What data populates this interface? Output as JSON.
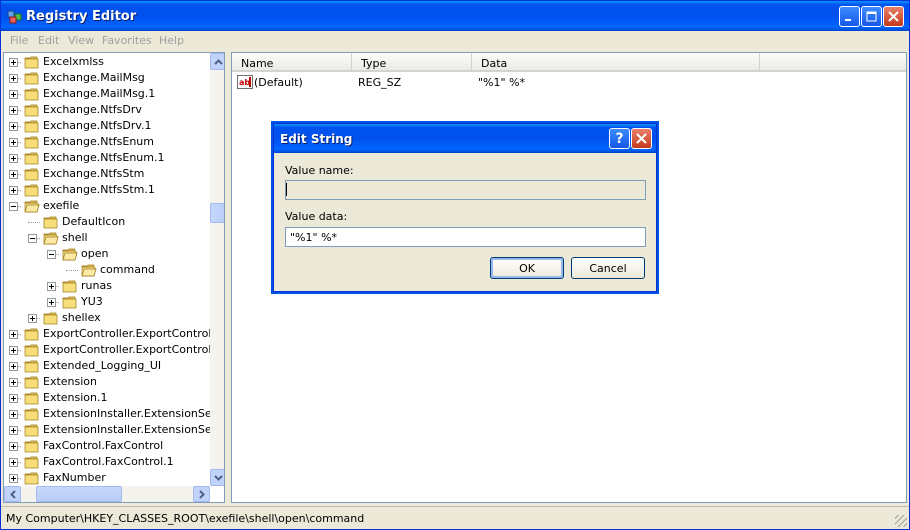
{
  "window": {
    "title": "Registry Editor"
  },
  "menu": [
    "File",
    "Edit",
    "View",
    "Favorites",
    "Help"
  ],
  "tree": [
    {
      "label": "Excelxmlss",
      "depth": 0,
      "expander": "plus"
    },
    {
      "label": "Exchange.MailMsg",
      "depth": 0,
      "expander": "plus"
    },
    {
      "label": "Exchange.MailMsg.1",
      "depth": 0,
      "expander": "plus"
    },
    {
      "label": "Exchange.NtfsDrv",
      "depth": 0,
      "expander": "plus"
    },
    {
      "label": "Exchange.NtfsDrv.1",
      "depth": 0,
      "expander": "plus"
    },
    {
      "label": "Exchange.NtfsEnum",
      "depth": 0,
      "expander": "plus"
    },
    {
      "label": "Exchange.NtfsEnum.1",
      "depth": 0,
      "expander": "plus"
    },
    {
      "label": "Exchange.NtfsStm",
      "depth": 0,
      "expander": "plus"
    },
    {
      "label": "Exchange.NtfsStm.1",
      "depth": 0,
      "expander": "plus"
    },
    {
      "label": "exefile",
      "depth": 0,
      "expander": "minus"
    },
    {
      "label": "DefaultIcon",
      "depth": 1,
      "expander": "none"
    },
    {
      "label": "shell",
      "depth": 1,
      "expander": "minus"
    },
    {
      "label": "open",
      "depth": 2,
      "expander": "minus"
    },
    {
      "label": "command",
      "depth": 3,
      "expander": "none",
      "selected": true
    },
    {
      "label": "runas",
      "depth": 2,
      "expander": "plus"
    },
    {
      "label": "YU3",
      "depth": 2,
      "expander": "plus"
    },
    {
      "label": "shellex",
      "depth": 1,
      "expander": "plus"
    },
    {
      "label": "ExportController.ExportControl",
      "depth": 0,
      "expander": "plus"
    },
    {
      "label": "ExportController.ExportControl",
      "depth": 0,
      "expander": "plus"
    },
    {
      "label": "Extended_Logging_UI",
      "depth": 0,
      "expander": "plus"
    },
    {
      "label": "Extension",
      "depth": 0,
      "expander": "plus"
    },
    {
      "label": "Extension.1",
      "depth": 0,
      "expander": "plus"
    },
    {
      "label": "ExtensionInstaller.ExtensionSe",
      "depth": 0,
      "expander": "plus"
    },
    {
      "label": "ExtensionInstaller.ExtensionSe",
      "depth": 0,
      "expander": "plus"
    },
    {
      "label": "FaxControl.FaxControl",
      "depth": 0,
      "expander": "plus"
    },
    {
      "label": "FaxControl.FaxControl.1",
      "depth": 0,
      "expander": "plus"
    },
    {
      "label": "FaxNumber",
      "depth": 0,
      "expander": "plus"
    }
  ],
  "list": {
    "columns": [
      "Name",
      "Type",
      "Data"
    ],
    "rows": [
      {
        "name": "(Default)",
        "type": "REG_SZ",
        "data": "\"%1\" %*"
      }
    ]
  },
  "status": "My Computer\\HKEY_CLASSES_ROOT\\exefile\\shell\\open\\command",
  "dialog": {
    "title": "Edit String",
    "help": "?",
    "value_name_label": "Value name:",
    "value_name": "",
    "value_data_label": "Value data:",
    "value_data": "\"%1\" %*",
    "ok": "OK",
    "cancel": "Cancel"
  },
  "colors": {
    "title_blue": "#0054e3",
    "close_red": "#c4391b",
    "chrome": "#ece9d8"
  }
}
